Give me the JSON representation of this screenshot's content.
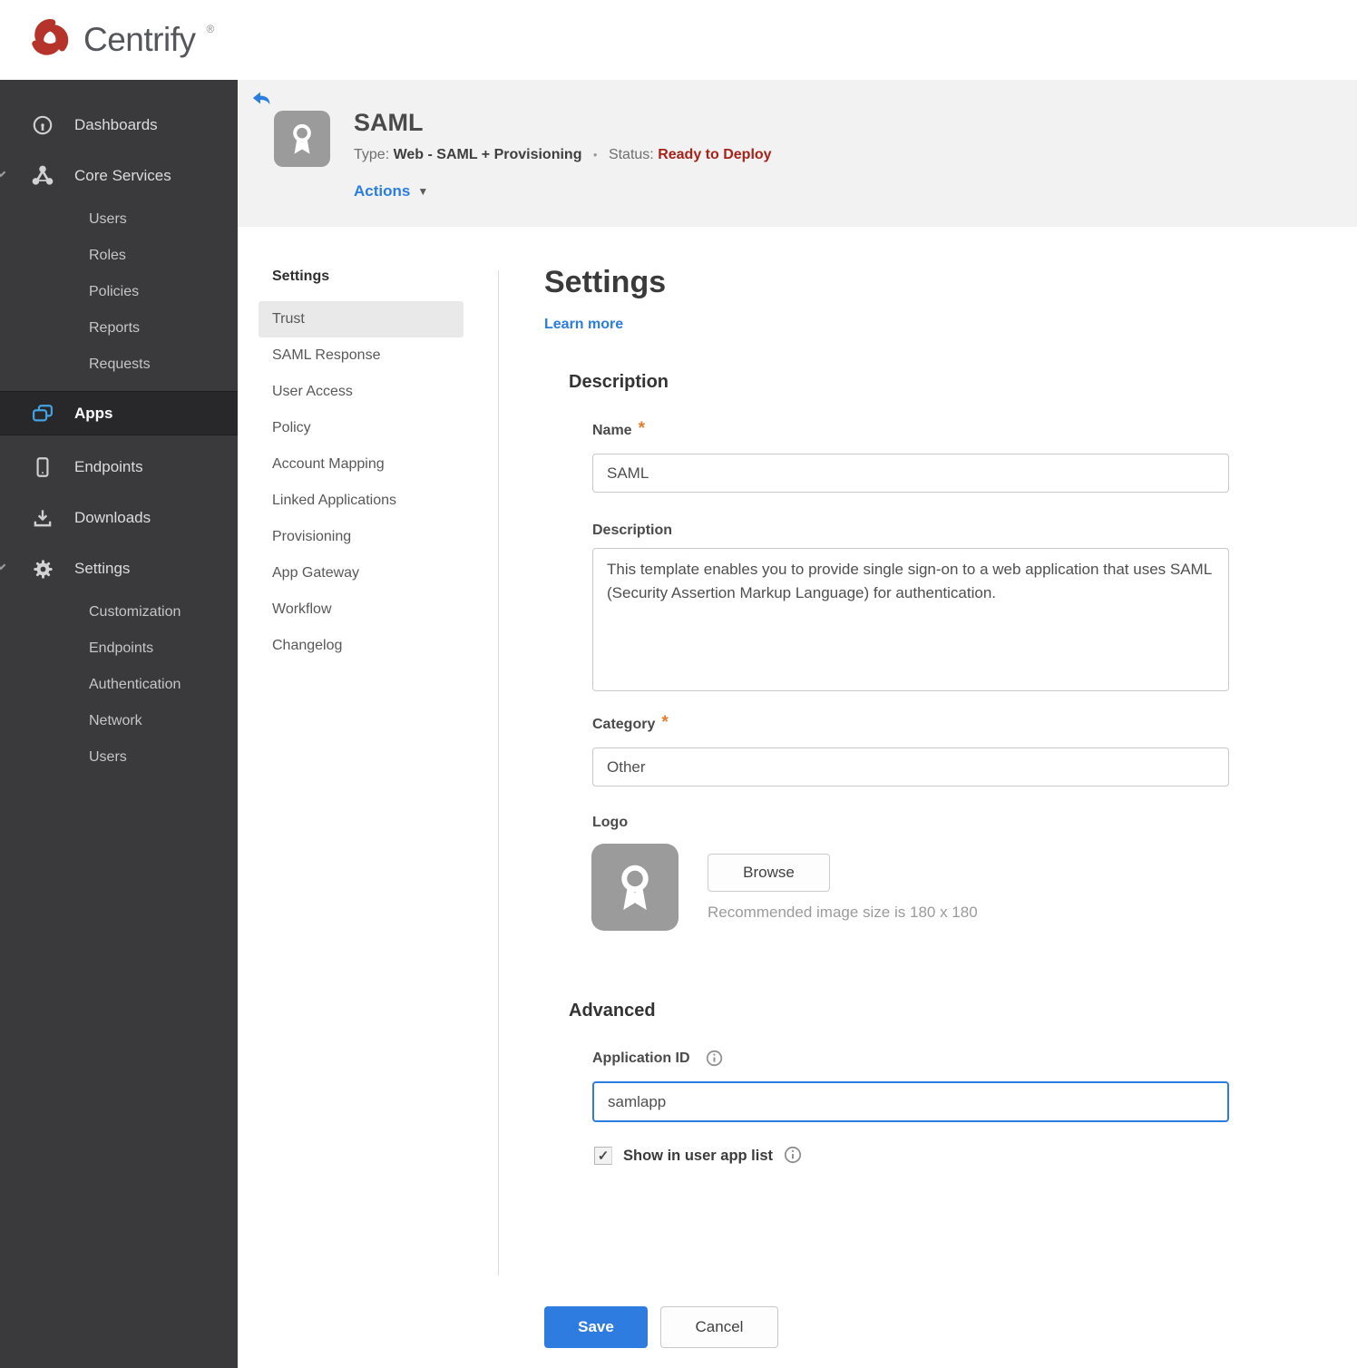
{
  "brand": {
    "name": "Centrify",
    "trademark": "®",
    "mark_color": "#b5332a"
  },
  "icons": {
    "checkmark_glyph": "✓",
    "caret_down_glyph": "▼",
    "meta_separator": "•"
  },
  "colors": {
    "accent_blue": "#2b7de0",
    "status_red": "#a5231a",
    "required_orange": "#e87a2b",
    "sidebar_bg": "#3a3a3c",
    "active_app_icon_blue": "#45a2e2",
    "save_button_bg": "#2e7ce0"
  },
  "sidebar": {
    "items": [
      {
        "label": "Dashboards",
        "icon": "gauge-icon",
        "level": "top"
      },
      {
        "label": "Core Services",
        "icon": "core-services-icon",
        "level": "top",
        "expanded": true
      },
      {
        "label": "Users",
        "level": "sub"
      },
      {
        "label": "Roles",
        "level": "sub"
      },
      {
        "label": "Policies",
        "level": "sub"
      },
      {
        "label": "Reports",
        "level": "sub"
      },
      {
        "label": "Requests",
        "level": "sub"
      },
      {
        "label": "Apps",
        "icon": "apps-icon",
        "level": "top",
        "active": true
      },
      {
        "label": "Endpoints",
        "icon": "phone-icon",
        "level": "top"
      },
      {
        "label": "Downloads",
        "icon": "download-icon",
        "level": "top"
      },
      {
        "label": "Settings",
        "icon": "gear-icon",
        "level": "top",
        "expanded": true
      },
      {
        "label": "Customization",
        "level": "sub"
      },
      {
        "label": "Endpoints",
        "level": "sub"
      },
      {
        "label": "Authentication",
        "level": "sub"
      },
      {
        "label": "Network",
        "level": "sub"
      },
      {
        "label": "Users",
        "level": "sub"
      }
    ]
  },
  "app_header": {
    "title": "SAML",
    "type_label": "Type:",
    "type_value": "Web - SAML + Provisioning",
    "status_label": "Status:",
    "status_value": "Ready to Deploy",
    "actions_label": "Actions"
  },
  "subnav": {
    "heading": "Settings",
    "active_item": "Trust",
    "items": [
      "Trust",
      "SAML Response",
      "User Access",
      "Policy",
      "Account Mapping",
      "Linked Applications",
      "Provisioning",
      "App Gateway",
      "Workflow",
      "Changelog"
    ]
  },
  "main": {
    "title": "Settings",
    "learn_more_label": "Learn more",
    "description_section": {
      "heading": "Description",
      "name_label": "Name",
      "name_value": "SAML",
      "description_label": "Description",
      "description_value": "This template enables you to provide single sign-on to a web application that uses SAML (Security Assertion Markup Language) for authentication.",
      "category_label": "Category",
      "category_value": "Other",
      "logo_label": "Logo",
      "browse_label": "Browse",
      "logo_hint": "Recommended image size is 180 x 180"
    },
    "advanced_section": {
      "heading": "Advanced",
      "application_id_label": "Application ID",
      "application_id_value": "samlapp",
      "show_in_app_list_label": "Show in user app list",
      "checkbox_checked": true
    },
    "footer": {
      "save_label": "Save",
      "cancel_label": "Cancel"
    }
  }
}
